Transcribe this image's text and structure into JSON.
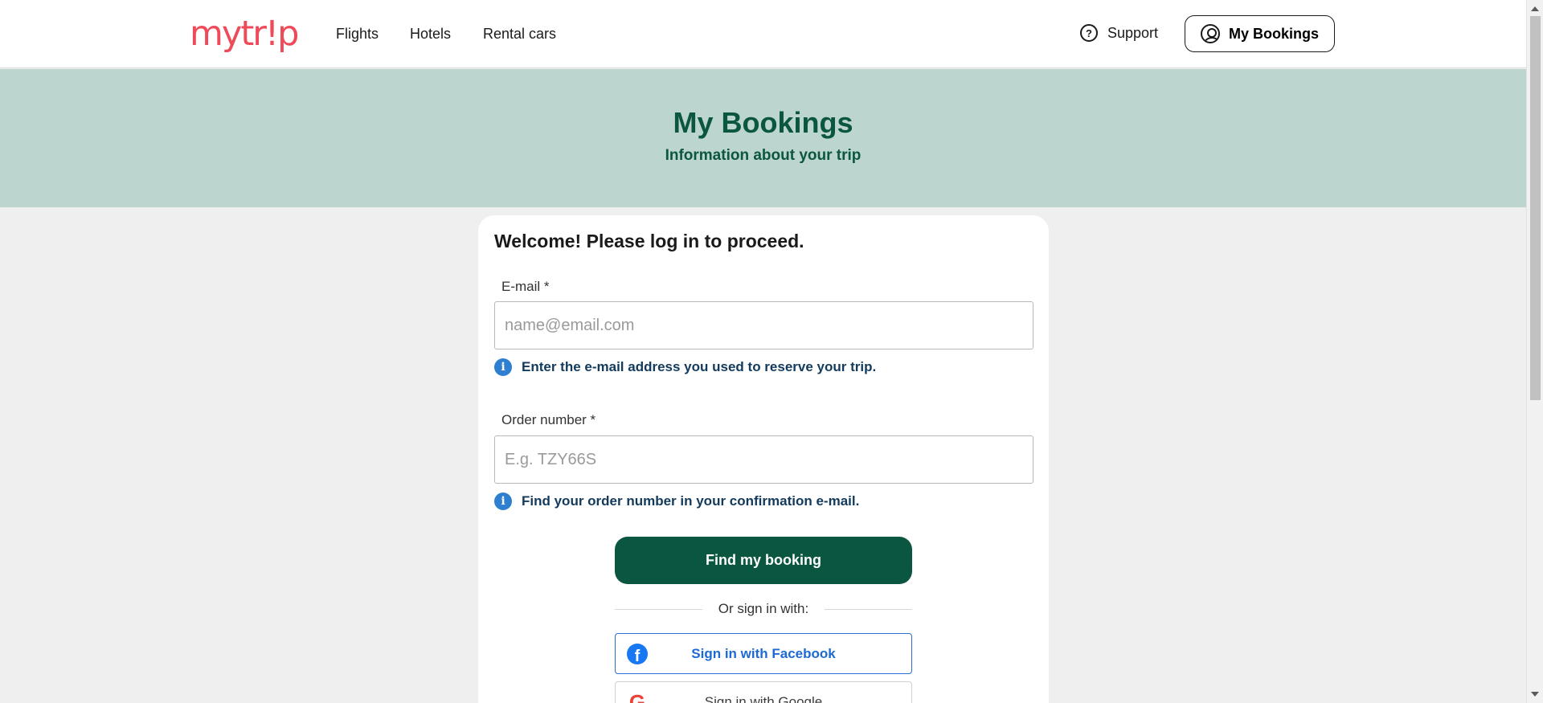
{
  "header": {
    "logo_text": "mytr!p",
    "nav": [
      {
        "label": "Flights"
      },
      {
        "label": "Hotels"
      },
      {
        "label": "Rental cars"
      }
    ],
    "support_label": "Support",
    "support_icon": "question-circle-icon",
    "my_bookings_label": "My Bookings",
    "my_bookings_icon": "user-circle-icon"
  },
  "hero": {
    "title": "My Bookings",
    "subtitle": "Information about your trip"
  },
  "form": {
    "welcome": "Welcome! Please log in to proceed.",
    "email": {
      "label": "E-mail *",
      "placeholder": "name@email.com",
      "value": "",
      "hint": "Enter the e-mail address you used to reserve your trip."
    },
    "order": {
      "label": "Order number *",
      "placeholder": "E.g. TZY66S",
      "value": "",
      "hint": "Find your order number in your confirmation e-mail."
    },
    "submit_label": "Find my booking",
    "divider_text": "Or sign in with:",
    "facebook_label": "Sign in with Facebook",
    "google_label": "Sign in with Google"
  },
  "colors": {
    "brand": "#ee4a5a",
    "primary": "#0b5640",
    "hero_bg": "#bdd5cf",
    "hint_text": "#123a5c",
    "info_icon": "#2f7fd1",
    "facebook": "#1c6ad2"
  }
}
